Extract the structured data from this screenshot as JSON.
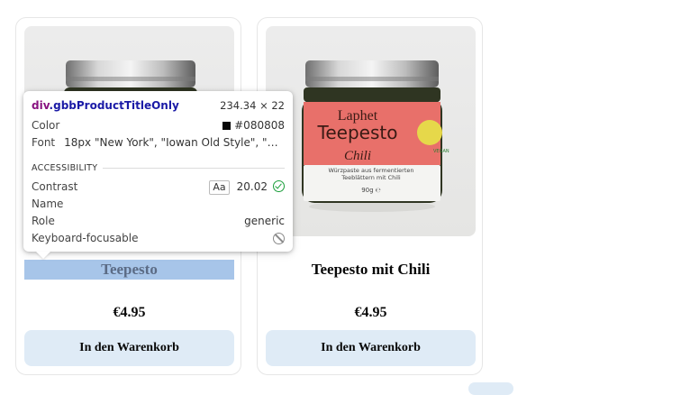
{
  "products": [
    {
      "title": "Teepesto",
      "price": "€4.95",
      "cart_label": "In den Warenkorb"
    },
    {
      "title": "Teepesto mit Chili",
      "price": "€4.95",
      "cart_label": "In den Warenkorb",
      "jar_label": {
        "brand": "Laphet",
        "name": "Teepesto",
        "variant": "Chili",
        "desc1": "Würzpaste aus fermentierten",
        "desc2": "Teeblättern mit Chili",
        "weight": "90g ℮",
        "badge": "VEGAN"
      }
    }
  ],
  "inspector": {
    "selector_tag": "div",
    "selector_class": ".gbbProductTitleOnly",
    "dimensions": "234.34 × 22",
    "color_label": "Color",
    "color_value": "#080808",
    "font_label": "Font",
    "font_value": "18px \"New York\", \"Iowan Old Style\", \"App...",
    "section_title": "ACCESSIBILITY",
    "contrast_label": "Contrast",
    "contrast_aa": "Aa",
    "contrast_value": "20.02",
    "name_label": "Name",
    "role_label": "Role",
    "role_value": "generic",
    "keyboard_label": "Keyboard-focusable"
  },
  "colors": {
    "highlight": "#a7c5e9",
    "button_bg": "#dfebf6",
    "jar_label_red": "#e8706a"
  }
}
